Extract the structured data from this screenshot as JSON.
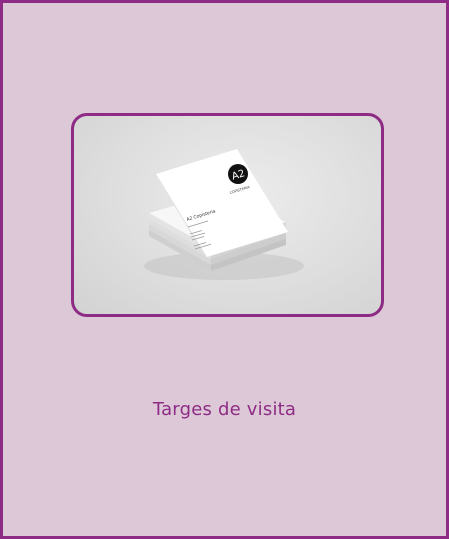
{
  "card": {
    "title": "Targes de visita",
    "image_alt": "Targes de visita mockup"
  },
  "business_card": {
    "logo_text": "A2",
    "logo_subtext": "COPISTERIA",
    "company_name": "A2 Copisteria"
  },
  "colors": {
    "accent": "#8e2b85",
    "background": "#dcc8d6"
  }
}
